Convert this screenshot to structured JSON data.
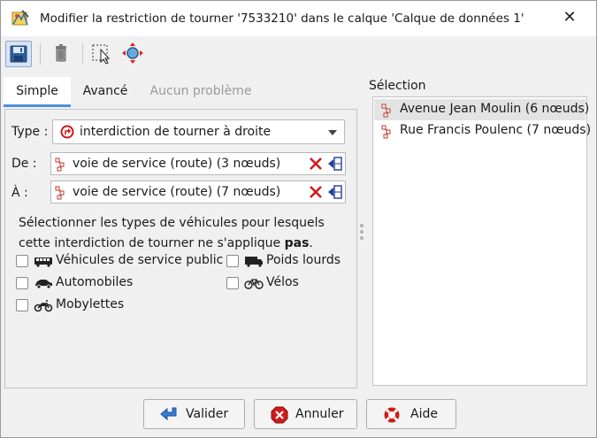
{
  "window": {
    "title": "Modifier la restriction de tourner '7533210' dans le calque 'Calque de données 1'",
    "close_symbol": "✕"
  },
  "toolbar": {
    "buttons": [
      {
        "icon": "save-icon"
      },
      {
        "icon": "trash-icon"
      },
      {
        "icon": "select-relation-members-icon"
      },
      {
        "icon": "zoom-to-relation-icon"
      }
    ]
  },
  "tabs": [
    {
      "label": "Simple",
      "state": "active"
    },
    {
      "label": "Avancé",
      "state": "normal"
    },
    {
      "label": "Aucun problème",
      "state": "disabled"
    }
  ],
  "form": {
    "type_label": "Type :",
    "type_value": "interdiction de tourner à droite",
    "from_label": "De :",
    "from_value": "voie de service (route) (3 nœuds)",
    "to_label": "À :",
    "to_value": "voie de service (route) (7 nœuds)",
    "vehicle_intro": "Sélectionner les types de véhicules pour lesquels cette interdiction de tourner ne s'applique ",
    "vehicle_intro_bold": "pas",
    "vehicle_intro_end": ".",
    "vehicles": [
      {
        "label": "Véhicules de service public",
        "icon": "bus-icon",
        "checked": false
      },
      {
        "label": "Poids lourds",
        "icon": "truck-icon",
        "checked": false
      },
      {
        "label": "Automobiles",
        "icon": "car-icon",
        "checked": false
      },
      {
        "label": "Vélos",
        "icon": "bicycle-icon",
        "checked": false
      },
      {
        "label": "Mobylettes",
        "icon": "moped-icon",
        "checked": false
      }
    ]
  },
  "selection": {
    "title": "Sélection",
    "items": [
      {
        "label": "Avenue Jean Moulin (6 nœuds)",
        "selected": true
      },
      {
        "label": "Rue Francis Poulenc (7 nœuds)",
        "selected": false
      }
    ]
  },
  "buttons": {
    "ok": "Valider",
    "cancel": "Annuler",
    "help": "Aide"
  },
  "colors": {
    "accent": "#4a90d9",
    "way_icon": "#c0392b",
    "delete": "#d11a1a"
  }
}
